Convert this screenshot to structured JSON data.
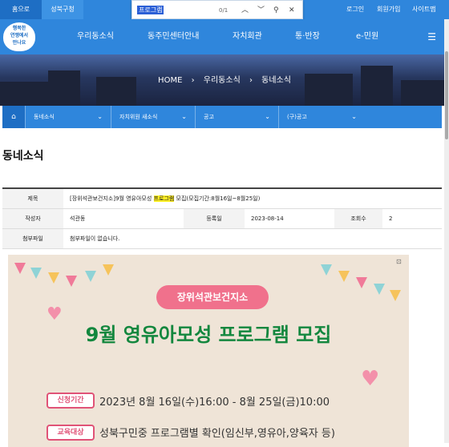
{
  "top": {
    "home": "홈으로",
    "district": "성북구청",
    "login": "로그인",
    "signup": "회원가입",
    "sitemap": "사이트맵"
  },
  "find": {
    "query": "프로그램",
    "count": "0/1"
  },
  "logo": {
    "line1": "행복한",
    "line2": "연맹에서",
    "line3": "만나요"
  },
  "nav": {
    "items": [
      "우리동소식",
      "동주민센터안내",
      "자치회관",
      "통·반장",
      "e-민원"
    ],
    "menu_icon": "menu-icon"
  },
  "hero": {
    "crumb": [
      "HOME",
      "우리동소식",
      "동네소식"
    ],
    "sep": "›"
  },
  "subnav": {
    "items": [
      "동네소식",
      "자치위원 새소식",
      "공고",
      "(구)공고"
    ]
  },
  "page": {
    "title": "동네소식"
  },
  "post": {
    "labels": {
      "subject": "제목",
      "author": "작성자",
      "date": "등록일",
      "views": "조회수",
      "attach": "첨부파일"
    },
    "subject_pre": "[장위석관보건지소]9월 영유아모성 ",
    "subject_hl": "프로그램",
    "subject_post": " 모집(모집기간:8월16일~8월25일)",
    "author": "석관동",
    "date": "2023-08-14",
    "views": "2",
    "attach": "첨부파일이 없습니다."
  },
  "poster": {
    "org": "장위석관보건지소",
    "title": "9월 영유아모성 프로그램 모집",
    "period_label": "신청기간",
    "period": "2023년 8월 16일(수)16:00 - 8월 25일(금)10:00",
    "target_label": "교육대상",
    "target": "성북구민중 프로그램별 확인(임신부,영유아,양육자 등)"
  }
}
